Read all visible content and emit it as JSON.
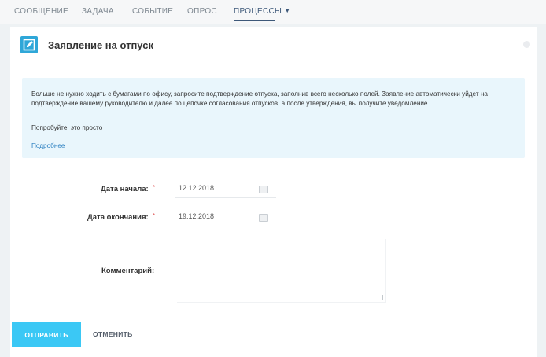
{
  "tabs": [
    {
      "label": "Сообщение"
    },
    {
      "label": "Задача"
    },
    {
      "label": "Событие"
    },
    {
      "label": "Опрос"
    },
    {
      "label": "Процессы",
      "active": true
    }
  ],
  "form": {
    "title": "Заявление на отпуск",
    "info": {
      "text": "Больше не нужно ходить с бумагами по офису, запросите подтверждение отпуска, заполнив всего несколько полей. Заявление автоматически уйдет на подтверждение вашему руководителю и далее по цепочке согласования отпусков, а после утверждения, вы получите уведомление.",
      "try_text": "Попробуйте, это просто",
      "more_link": "Подробнее"
    },
    "fields": {
      "start": {
        "label": "Дата начала:",
        "required_mark": "*",
        "value": "12.12.2018"
      },
      "end": {
        "label": "Дата окончания:",
        "required_mark": "*",
        "value": "19.12.2018"
      },
      "comment": {
        "label": "Комментарий:",
        "value": ""
      }
    },
    "buttons": {
      "submit": "Отправить",
      "cancel": "Отменить"
    }
  },
  "colors": {
    "accent": "#3bc8f5",
    "icon": "#2fa7d8",
    "info_bg": "#e9f6fc",
    "link": "#2a7fc0",
    "active_tab": "#3d5879"
  },
  "icons": {
    "form_icon": "edit-form-icon",
    "calendar": "calendar-icon"
  }
}
